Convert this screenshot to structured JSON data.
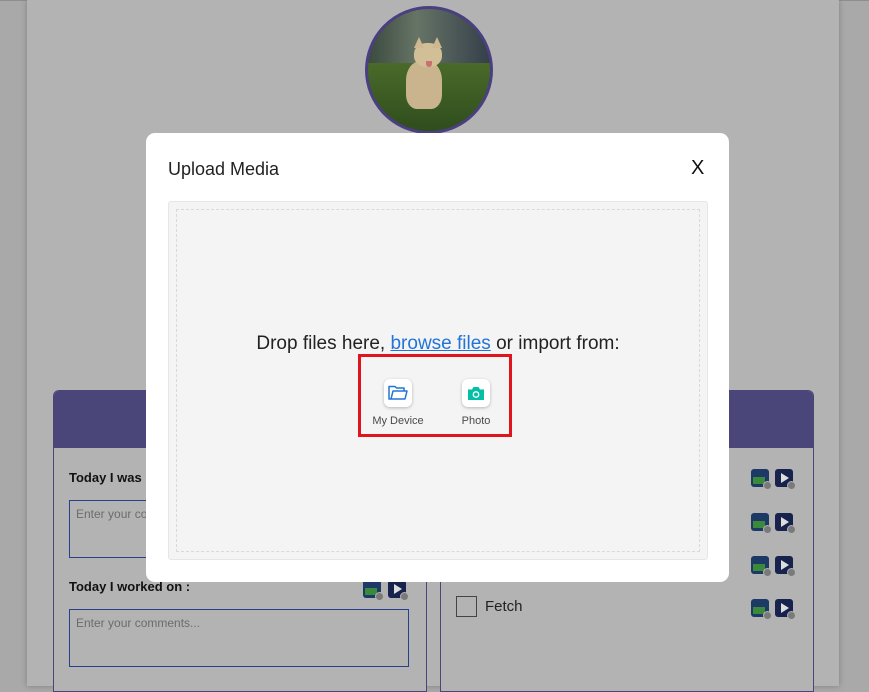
{
  "background": {
    "today_i_was_label": "Today I was :",
    "today_i_was_placeholder": "Enter your co",
    "today_i_worked_label": "Today I worked on :",
    "today_i_worked_placeholder": "Enter your comments...",
    "fetch_label": "Fetch"
  },
  "modal": {
    "title": "Upload Media",
    "close_label": "X",
    "drop_prefix": "Drop files here,",
    "browse_label": "browse files",
    "drop_suffix": "or import from:",
    "sources": [
      {
        "label": "My Device",
        "icon": "folder-icon"
      },
      {
        "label": "Photo",
        "icon": "camera-icon"
      }
    ]
  },
  "colors": {
    "accent": "#4b4679",
    "link": "#2275d7",
    "highlight": "#e0141e",
    "camera": "#03bfa5"
  }
}
